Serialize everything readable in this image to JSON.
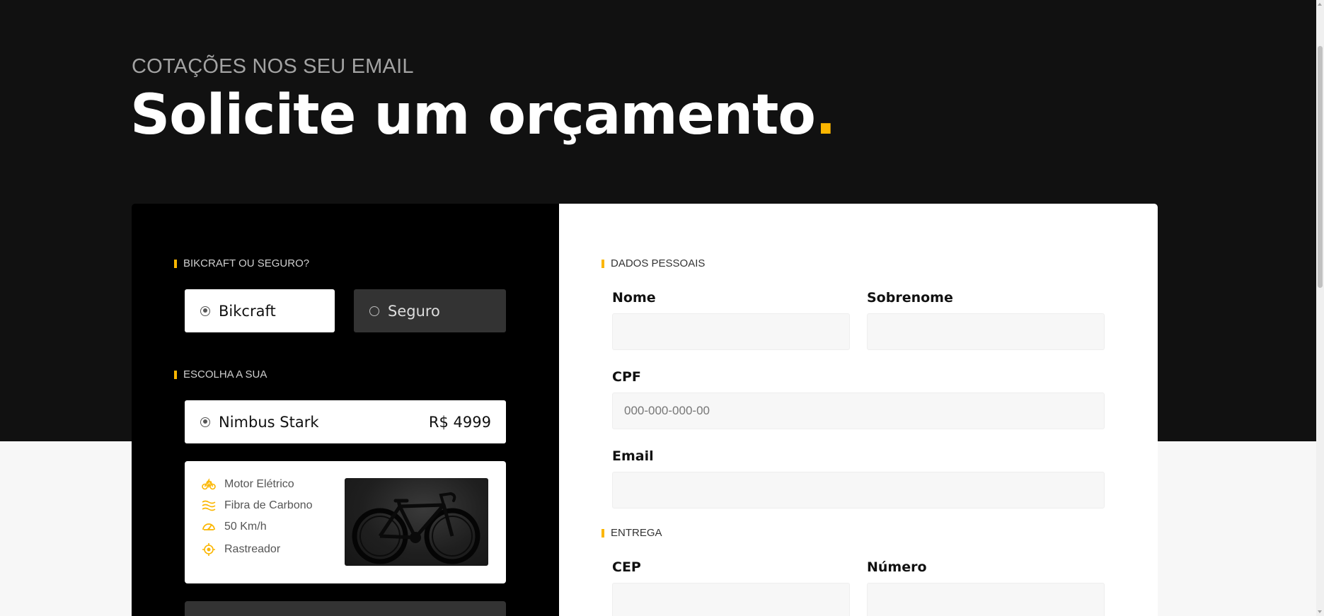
{
  "hero": {
    "subtitle": "COTAÇÕES NOS SEU EMAIL",
    "title": "Solicite um orçamento",
    "title_dot": "."
  },
  "left": {
    "section1_label": "BIKCRAFT OU SEGURO?",
    "options": [
      {
        "label": "Bikcraft",
        "selected": true
      },
      {
        "label": "Seguro",
        "selected": false
      }
    ],
    "section2_label": "ESCOLHA A SUA",
    "bike_option": {
      "name": "Nimbus Stark",
      "price": "R$ 4999",
      "selected": true
    },
    "specs": [
      {
        "icon": "electric-bike-icon",
        "label": "Motor Elétrico"
      },
      {
        "icon": "carbon-fiber-icon",
        "label": "Fibra de Carbono"
      },
      {
        "icon": "speedometer-icon",
        "label": "50 Km/h"
      },
      {
        "icon": "tracker-icon",
        "label": "Rastreador"
      }
    ]
  },
  "right": {
    "section1_label": "DADOS PESSOAIS",
    "fields": {
      "nome": {
        "label": "Nome",
        "value": "",
        "placeholder": ""
      },
      "sobrenome": {
        "label": "Sobrenome",
        "value": "",
        "placeholder": ""
      },
      "cpf": {
        "label": "CPF",
        "value": "",
        "placeholder": "000-000-000-00"
      },
      "email": {
        "label": "Email",
        "value": "",
        "placeholder": ""
      },
      "cep": {
        "label": "CEP",
        "value": "",
        "placeholder": ""
      },
      "numero": {
        "label": "Número",
        "value": "",
        "placeholder": ""
      }
    },
    "section2_label": "ENTREGA"
  },
  "colors": {
    "accent": "#fbb600",
    "hero_bg": "#111111",
    "panel_dark": "#000000",
    "panel_light": "#ffffff"
  }
}
